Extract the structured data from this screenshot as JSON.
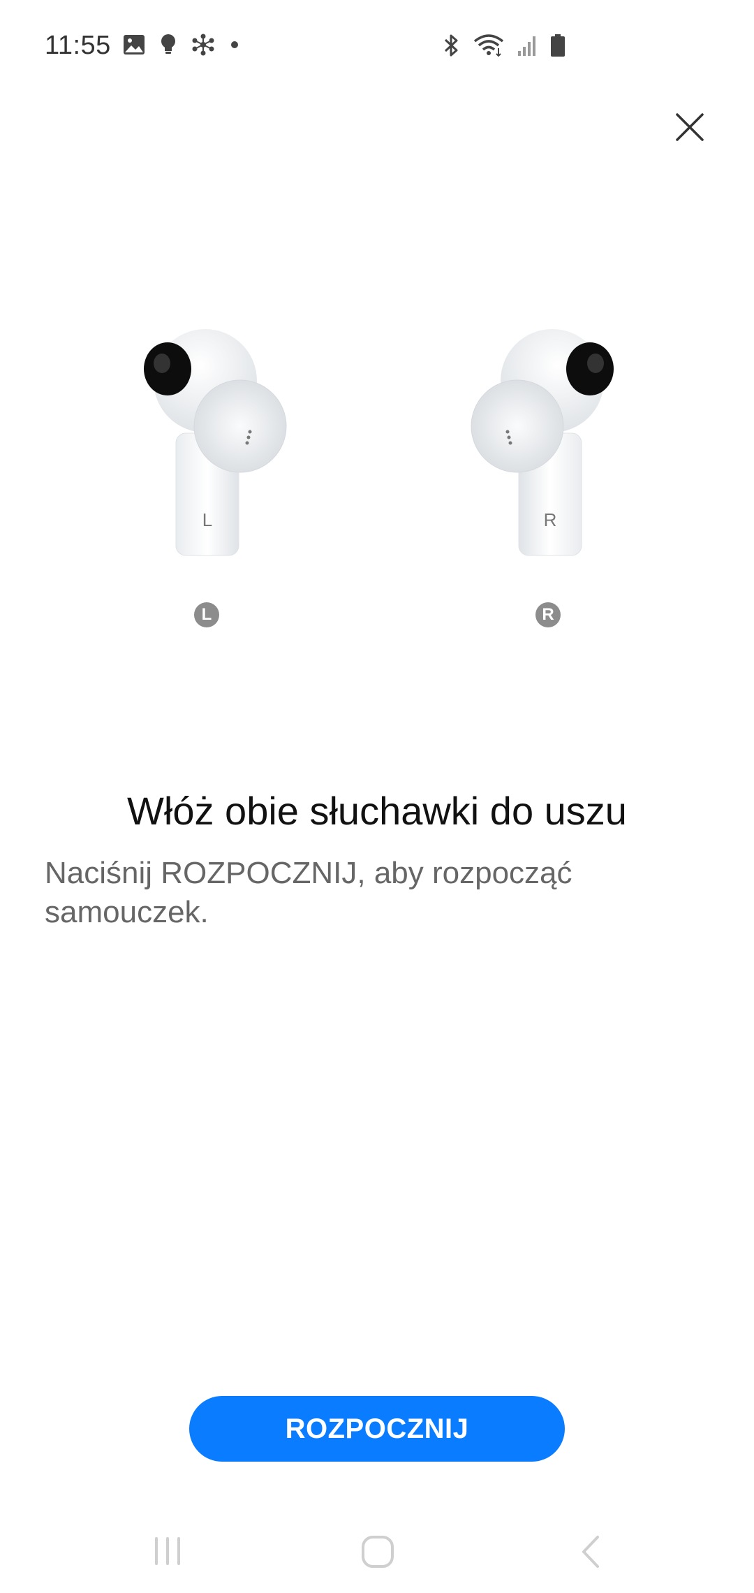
{
  "status_bar": {
    "time": "11:55",
    "left_icons": [
      "image-icon",
      "lightbulb-icon",
      "network-icon",
      "dot-icon"
    ],
    "right_icons": [
      "bluetooth-icon",
      "wifi-icon",
      "signal-icon",
      "battery-icon"
    ]
  },
  "close": {
    "icon": "close-icon"
  },
  "earbuds": {
    "left": {
      "stem_letter": "L",
      "badge": "L"
    },
    "right": {
      "stem_letter": "R",
      "badge": "R"
    }
  },
  "main": {
    "title": "Włóż obie słuchawki do uszu",
    "description": "Naciśnij ROZPOCZNIJ, aby rozpocząć samouczek."
  },
  "actions": {
    "start_label": "ROZPOCZNIJ"
  },
  "nav_bar": {
    "items": [
      "recents-icon",
      "home-icon",
      "back-icon"
    ]
  },
  "colors": {
    "accent": "#0a7cff",
    "badge": "#8c8c8c",
    "text_primary": "#111111",
    "text_secondary": "#666666"
  }
}
